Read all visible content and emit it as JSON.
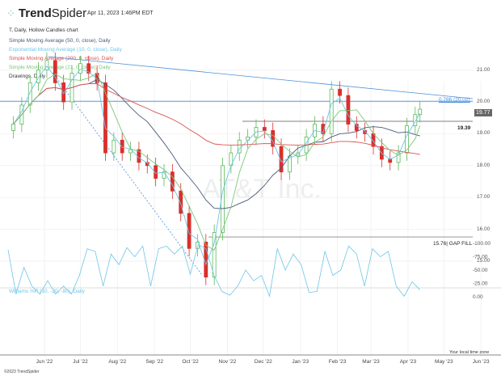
{
  "header": {
    "brand_bold": "Trend",
    "brand_light": "Spider",
    "timestamp": "Apr 11, 2023 1:46PM EDT",
    "chart_label": "T, Daily, Hollow Candles chart"
  },
  "legend": [
    {
      "label": "Simple Moving Average (50, 0, close), Daily",
      "color": "#4a5a7a",
      "type": "sma",
      "period": 10
    },
    {
      "label": "Exponential Moving Average (10, 0, close), Daily",
      "color": "#6cc6e8",
      "type": "ema",
      "period": 2
    },
    {
      "label": "Simple Moving Average (200, 0, close), Daily",
      "color": "#d9534f",
      "type": "sma",
      "period": 40
    },
    {
      "label": "Simple Moving Average (21, 0, close), Daily",
      "color": "#7cc67c",
      "type": "sma",
      "period": 4
    },
    {
      "label": "Drawings, Daily",
      "color": "#333333"
    }
  ],
  "watermark": "AT&T Inc.",
  "annotations": {
    "fib": "0.786 (20.02)",
    "fib_value": 20.02,
    "resistance": "19.39",
    "resistance_value": 19.39,
    "gap": "15.76| GAP FILL",
    "gap_value": 15.76,
    "last_price": "19.77"
  },
  "footer": {
    "copyright": "©2023 TrendSpider",
    "timezone": "Your local time zone"
  },
  "chart_data": [
    {
      "type": "candlestick",
      "title": "T, Daily, Hollow Candles chart",
      "ylim": [
        14.3,
        22
      ],
      "y_ticks": [
        "21.00",
        "20.00",
        "19.00",
        "18.00",
        "17.00",
        "16.00",
        "15.00"
      ],
      "x_ticks": [
        "Jun '22",
        "Jul '22",
        "Aug '22",
        "Sep '22",
        "Oct '22",
        "Nov '22",
        "Dec '22",
        "Jan '23",
        "Feb '23",
        "Mar '23",
        "Apr '23",
        "May '23",
        "Jun '23"
      ],
      "dates": [
        "2022-05-06",
        "2022-05-13",
        "2022-05-20",
        "2022-05-27",
        "2022-06-03",
        "2022-06-10",
        "2022-06-17",
        "2022-06-24",
        "2022-07-01",
        "2022-07-08",
        "2022-07-15",
        "2022-07-22",
        "2022-07-29",
        "2022-08-05",
        "2022-08-12",
        "2022-08-19",
        "2022-08-26",
        "2022-09-02",
        "2022-09-09",
        "2022-09-16",
        "2022-09-23",
        "2022-09-30",
        "2022-10-07",
        "2022-10-14",
        "2022-10-21",
        "2022-10-28",
        "2022-11-04",
        "2022-11-11",
        "2022-11-18",
        "2022-11-25",
        "2022-12-02",
        "2022-12-09",
        "2022-12-16",
        "2022-12-23",
        "2022-12-30",
        "2023-01-06",
        "2023-01-13",
        "2023-01-20",
        "2023-01-27",
        "2023-02-03",
        "2023-02-10",
        "2023-02-17",
        "2023-02-24",
        "2023-03-03",
        "2023-03-10",
        "2023-03-17",
        "2023-03-24",
        "2023-03-31",
        "2023-04-07",
        "2023-04-11"
      ],
      "close": [
        19.3,
        19.9,
        20.6,
        21.0,
        21.3,
        20.6,
        20.0,
        20.9,
        21.2,
        20.9,
        20.6,
        18.4,
        18.8,
        18.4,
        18.5,
        18.1,
        18.0,
        17.6,
        17.8,
        17.2,
        16.5,
        15.4,
        15.6,
        14.5,
        15.9,
        18.0,
        18.4,
        18.8,
        18.9,
        19.2,
        19.1,
        18.6,
        17.8,
        18.3,
        18.4,
        18.9,
        19.3,
        19.0,
        20.4,
        20.2,
        19.3,
        19.1,
        19.0,
        18.6,
        18.2,
        18.1,
        18.4,
        19.25,
        19.6,
        19.77
      ]
    },
    {
      "type": "line",
      "title": "Williams %R (10, -20, -80), Daily",
      "ylim": [
        -100,
        0
      ],
      "y_ticks": [
        "0.00",
        "-25.00",
        "-50.00",
        "-75.00",
        "-100.00"
      ],
      "band": [
        -80,
        -20
      ],
      "values": [
        -88,
        -5,
        -55,
        -20,
        -5,
        -30,
        -5,
        -20,
        -5,
        -40,
        -90,
        -85,
        -20,
        -80,
        -60,
        -92,
        -75,
        -95,
        -20,
        -90,
        -95,
        -80,
        -95,
        -42,
        -98,
        -90,
        -40,
        -10,
        -3,
        -20,
        -50,
        -30,
        -40,
        -1,
        -90,
        -50,
        -80,
        -60,
        -8,
        -10,
        -85,
        -40,
        -50,
        -95,
        -80,
        -20,
        -90,
        -75,
        -85,
        -20,
        -1,
        -28,
        -13
      ]
    }
  ]
}
